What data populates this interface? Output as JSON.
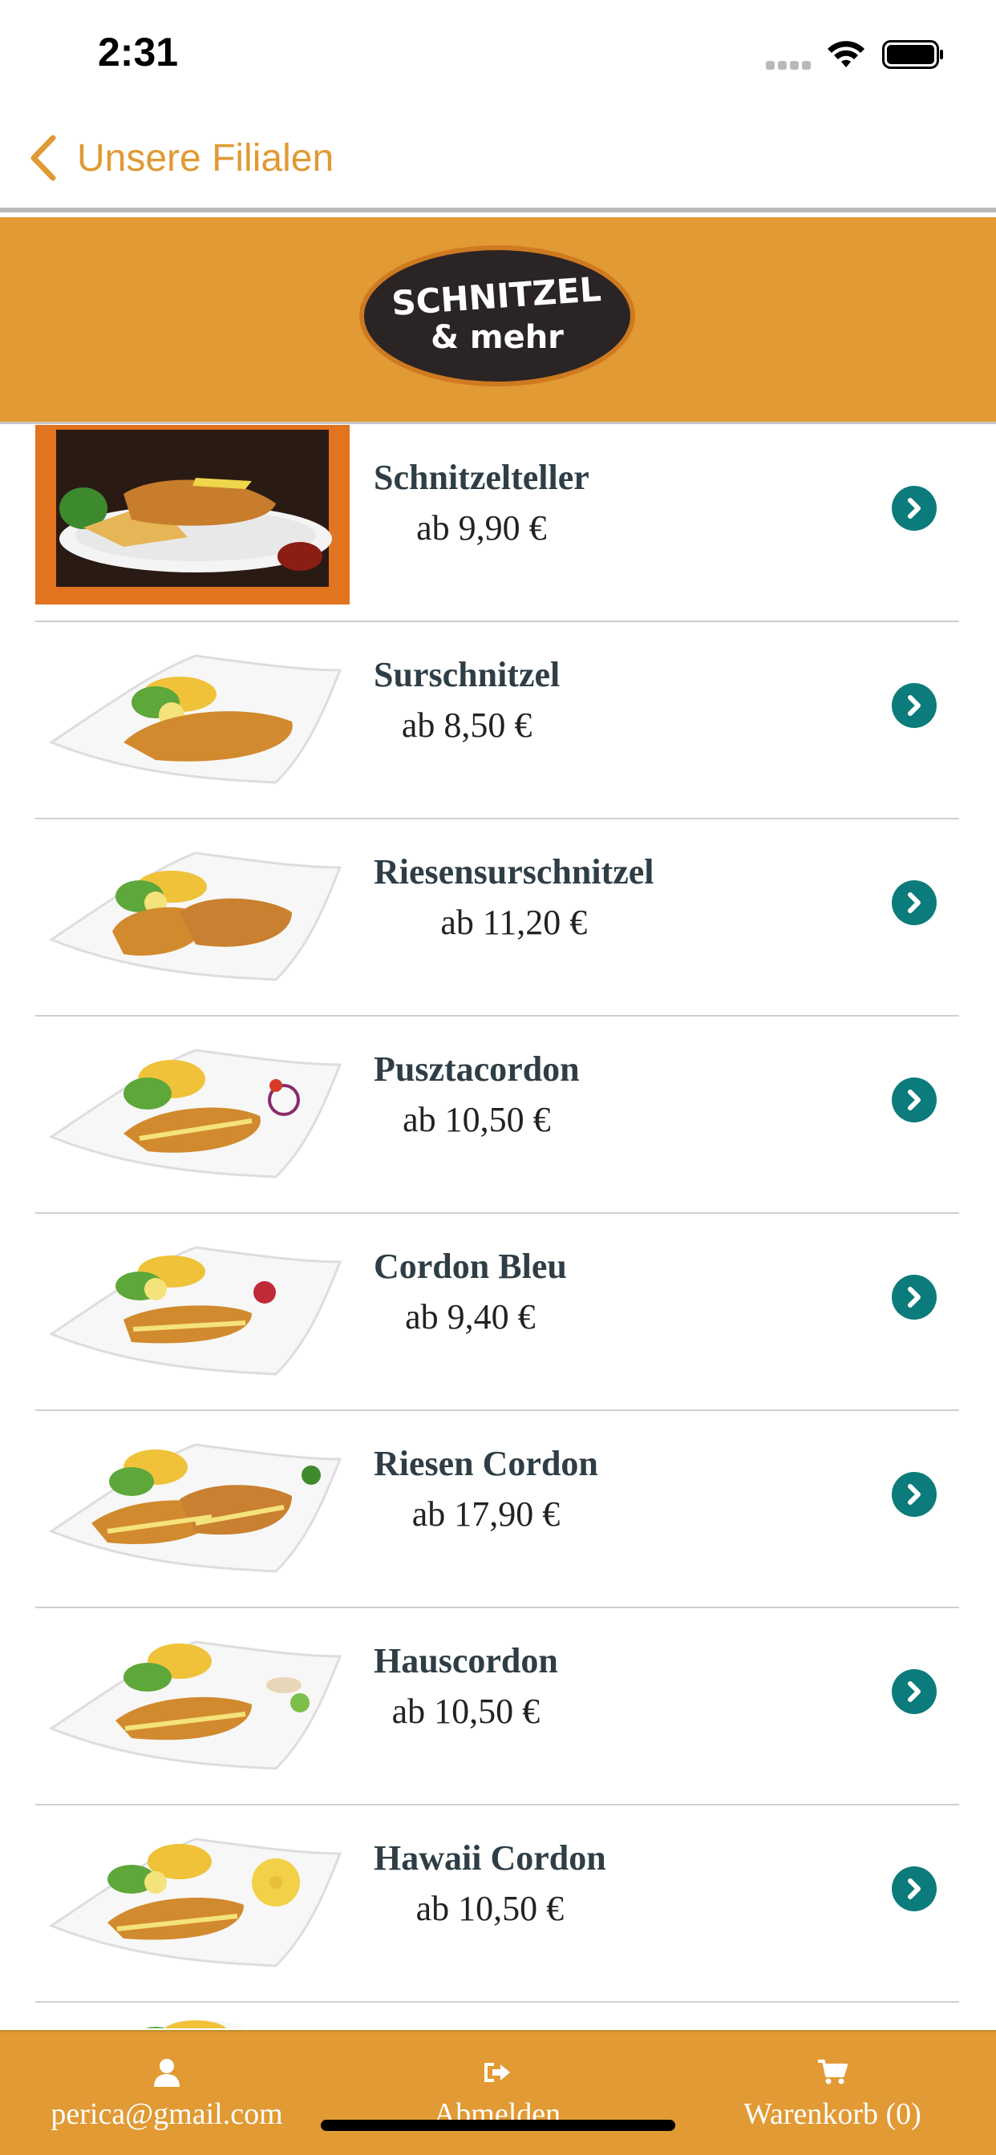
{
  "status_bar": {
    "time": "2:31"
  },
  "nav": {
    "back_label": "Unsere Filialen"
  },
  "brand": {
    "logo_line1": "SCHNITZEL",
    "logo_line2": "& mehr",
    "color": "#E19A34",
    "accent_teal": "#0C7B7B"
  },
  "menu": {
    "items": [
      {
        "name": "Schnitzelteller",
        "price": "ab 9,90 €"
      },
      {
        "name": "Surschnitzel",
        "price": "ab 8,50 €"
      },
      {
        "name": "Riesensurschnitzel",
        "price": "ab 11,20 €"
      },
      {
        "name": "Pusztacordon",
        "price": "ab 10,50 €"
      },
      {
        "name": "Cordon Bleu",
        "price": "ab 9,40 €"
      },
      {
        "name": "Riesen Cordon",
        "price": "ab 17,90 €"
      },
      {
        "name": "Hauscordon",
        "price": "ab 10,50 €"
      },
      {
        "name": "Hawaii Cordon",
        "price": "ab 10,50 €"
      }
    ]
  },
  "tab_bar": {
    "account_label": "perica@gmail.com",
    "logout_label": "Abmelden",
    "cart_label": "Warenkorb (0)",
    "icons": [
      "user-icon",
      "sign-out-icon",
      "cart-icon"
    ]
  }
}
